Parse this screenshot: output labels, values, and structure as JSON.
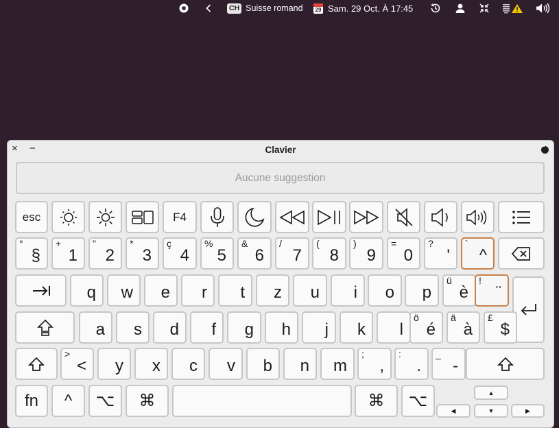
{
  "menubar": {
    "input_badge": "CH",
    "input_name": "Suisse romand",
    "calendar_day": "29",
    "datetime": "Sam. 29 Oct. À 17:45"
  },
  "window": {
    "title": "Clavier",
    "close": "×",
    "minimize": "−",
    "suggestion": "Aucune suggestion"
  },
  "row_fn": {
    "esc": "esc",
    "f4": "F4"
  },
  "row_num": [
    {
      "sec": "°",
      "main": "§"
    },
    {
      "sec": "+",
      "main": "1"
    },
    {
      "sec": "\"",
      "main": "2"
    },
    {
      "sec": "*",
      "main": "3"
    },
    {
      "sec": "ç",
      "main": "4"
    },
    {
      "sec": "%",
      "main": "5"
    },
    {
      "sec": "&",
      "main": "6"
    },
    {
      "sec": "/",
      "main": "7"
    },
    {
      "sec": "(",
      "main": "8"
    },
    {
      "sec": ")",
      "main": "9"
    },
    {
      "sec": "=",
      "main": "0"
    },
    {
      "sec": "?",
      "main": "'"
    },
    {
      "sec": "`",
      "main": "^"
    }
  ],
  "row_q": [
    {
      "sec": "",
      "main": "q"
    },
    {
      "sec": "",
      "main": "w"
    },
    {
      "sec": "",
      "main": "e"
    },
    {
      "sec": "",
      "main": "r"
    },
    {
      "sec": "",
      "main": "t"
    },
    {
      "sec": "",
      "main": "z"
    },
    {
      "sec": "",
      "main": "u"
    },
    {
      "sec": "",
      "main": "i"
    },
    {
      "sec": "",
      "main": "o"
    },
    {
      "sec": "",
      "main": "p"
    },
    {
      "sec": "ü",
      "main": "è"
    },
    {
      "sec": "!",
      "main": "¨"
    }
  ],
  "row_a": [
    {
      "sec": "",
      "main": "a"
    },
    {
      "sec": "",
      "main": "s"
    },
    {
      "sec": "",
      "main": "d"
    },
    {
      "sec": "",
      "main": "f"
    },
    {
      "sec": "",
      "main": "g"
    },
    {
      "sec": "",
      "main": "h"
    },
    {
      "sec": "",
      "main": "j"
    },
    {
      "sec": "",
      "main": "k"
    },
    {
      "sec": "",
      "main": "l"
    },
    {
      "sec": "ö",
      "main": "é"
    },
    {
      "sec": "ä",
      "main": "à"
    },
    {
      "sec": "£",
      "main": "$"
    }
  ],
  "row_y": [
    {
      "sec": ">",
      "main": "<"
    },
    {
      "sec": "",
      "main": "y"
    },
    {
      "sec": "",
      "main": "x"
    },
    {
      "sec": "",
      "main": "c"
    },
    {
      "sec": "",
      "main": "v"
    },
    {
      "sec": "",
      "main": "b"
    },
    {
      "sec": "",
      "main": "n"
    },
    {
      "sec": "",
      "main": "m"
    },
    {
      "sec": ";",
      "main": ","
    },
    {
      "sec": ":",
      "main": "."
    },
    {
      "sec": "_",
      "main": "-"
    }
  ],
  "row_bottom": {
    "fn": "fn",
    "ctrl": "^",
    "opt": "⌥",
    "cmd": "⌘",
    "arrow_up": "▲",
    "arrow_left": "◀",
    "arrow_down": "▼",
    "arrow_right": "▶"
  }
}
